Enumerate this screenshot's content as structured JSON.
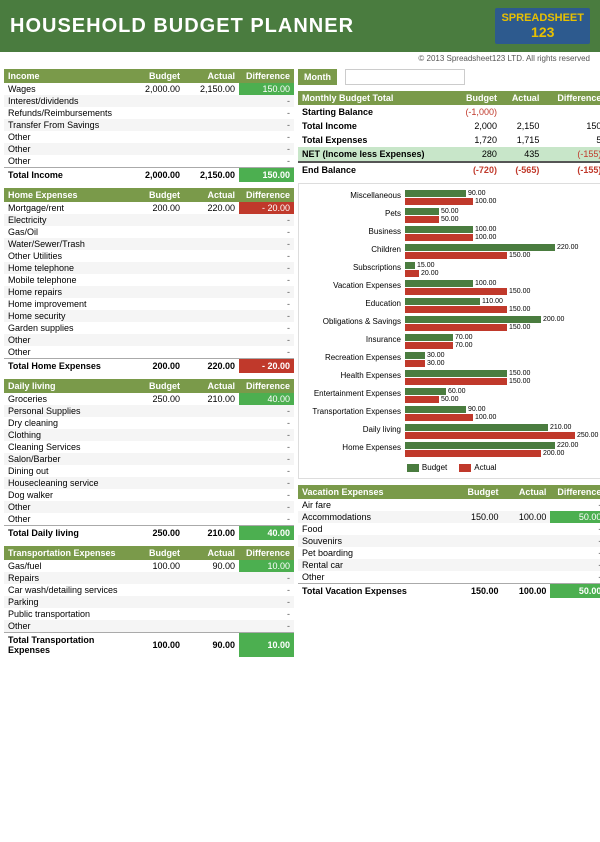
{
  "header": {
    "title": "HOUSEHOLD BUDGET PLANNER",
    "logo_line1": "SPREAD",
    "logo_line2": "SHEET",
    "logo_num": "123",
    "copyright": "© 2013 Spreadsheet123 LTD. All rights reserved"
  },
  "month": {
    "label": "Month",
    "value": ""
  },
  "income": {
    "header": "Income",
    "col_budget": "Budget",
    "col_actual": "Actual",
    "col_diff": "Difference",
    "rows": [
      {
        "label": "Wages",
        "budget": "2,000.00",
        "actual": "2,150.00",
        "diff": "150.00",
        "diff_type": "positive"
      },
      {
        "label": "Interest/dividends",
        "budget": "",
        "actual": "",
        "diff": "-",
        "diff_type": "neutral"
      },
      {
        "label": "Refunds/Reimbursements",
        "budget": "",
        "actual": "",
        "diff": "-",
        "diff_type": "neutral"
      },
      {
        "label": "Transfer From Savings",
        "budget": "",
        "actual": "",
        "diff": "-",
        "diff_type": "neutral"
      },
      {
        "label": "Other",
        "budget": "",
        "actual": "",
        "diff": "-",
        "diff_type": "neutral"
      },
      {
        "label": "Other",
        "budget": "",
        "actual": "",
        "diff": "-",
        "diff_type": "neutral"
      },
      {
        "label": "Other",
        "budget": "",
        "actual": "",
        "diff": "-",
        "diff_type": "neutral"
      }
    ],
    "total_label": "Total Income",
    "total_budget": "2,000.00",
    "total_actual": "2,150.00",
    "total_diff": "150.00",
    "total_diff_type": "positive"
  },
  "home_expenses": {
    "header": "Home Expenses",
    "col_budget": "Budget",
    "col_actual": "Actual",
    "col_diff": "Difference",
    "rows": [
      {
        "label": "Mortgage/rent",
        "budget": "200.00",
        "actual": "220.00",
        "diff": "- 20.00",
        "diff_type": "negative"
      },
      {
        "label": "Electricity",
        "budget": "",
        "actual": "",
        "diff": "-",
        "diff_type": "neutral"
      },
      {
        "label": "Gas/Oil",
        "budget": "",
        "actual": "",
        "diff": "-",
        "diff_type": "neutral"
      },
      {
        "label": "Water/Sewer/Trash",
        "budget": "",
        "actual": "",
        "diff": "-",
        "diff_type": "neutral"
      },
      {
        "label": "Other Utilities",
        "budget": "",
        "actual": "",
        "diff": "-",
        "diff_type": "neutral"
      },
      {
        "label": "Home telephone",
        "budget": "",
        "actual": "",
        "diff": "-",
        "diff_type": "neutral"
      },
      {
        "label": "Mobile telephone",
        "budget": "",
        "actual": "",
        "diff": "-",
        "diff_type": "neutral"
      },
      {
        "label": "Home repairs",
        "budget": "",
        "actual": "",
        "diff": "-",
        "diff_type": "neutral"
      },
      {
        "label": "Home improvement",
        "budget": "",
        "actual": "",
        "diff": "-",
        "diff_type": "neutral"
      },
      {
        "label": "Home security",
        "budget": "",
        "actual": "",
        "diff": "-",
        "diff_type": "neutral"
      },
      {
        "label": "Garden supplies",
        "budget": "",
        "actual": "",
        "diff": "-",
        "diff_type": "neutral"
      },
      {
        "label": "Other",
        "budget": "",
        "actual": "",
        "diff": "-",
        "diff_type": "neutral"
      },
      {
        "label": "Other",
        "budget": "",
        "actual": "",
        "diff": "-",
        "diff_type": "neutral"
      }
    ],
    "total_label": "Total Home Expenses",
    "total_budget": "200.00",
    "total_actual": "220.00",
    "total_diff": "- 20.00",
    "total_diff_type": "negative"
  },
  "daily_living": {
    "header": "Daily living",
    "col_budget": "Budget",
    "col_actual": "Actual",
    "col_diff": "Difference",
    "rows": [
      {
        "label": "Groceries",
        "budget": "250.00",
        "actual": "210.00",
        "diff": "40.00",
        "diff_type": "positive"
      },
      {
        "label": "Personal Supplies",
        "budget": "",
        "actual": "",
        "diff": "-",
        "diff_type": "neutral"
      },
      {
        "label": "Dry cleaning",
        "budget": "",
        "actual": "",
        "diff": "-",
        "diff_type": "neutral"
      },
      {
        "label": "Clothing",
        "budget": "",
        "actual": "",
        "diff": "-",
        "diff_type": "neutral"
      },
      {
        "label": "Cleaning Services",
        "budget": "",
        "actual": "",
        "diff": "-",
        "diff_type": "neutral"
      },
      {
        "label": "Salon/Barber",
        "budget": "",
        "actual": "",
        "diff": "-",
        "diff_type": "neutral"
      },
      {
        "label": "Dining out",
        "budget": "",
        "actual": "",
        "diff": "-",
        "diff_type": "neutral"
      },
      {
        "label": "Housecleaning service",
        "budget": "",
        "actual": "",
        "diff": "-",
        "diff_type": "neutral"
      },
      {
        "label": "Dog walker",
        "budget": "",
        "actual": "",
        "diff": "-",
        "diff_type": "neutral"
      },
      {
        "label": "Other",
        "budget": "",
        "actual": "",
        "diff": "-",
        "diff_type": "neutral"
      },
      {
        "label": "Other",
        "budget": "",
        "actual": "",
        "diff": "-",
        "diff_type": "neutral"
      }
    ],
    "total_label": "Total Daily living",
    "total_budget": "250.00",
    "total_actual": "210.00",
    "total_diff": "40.00",
    "total_diff_type": "positive"
  },
  "transport": {
    "header": "Transportation Expenses",
    "col_budget": "Budget",
    "col_actual": "Actual",
    "col_diff": "Difference",
    "rows": [
      {
        "label": "Gas/fuel",
        "budget": "100.00",
        "actual": "90.00",
        "diff": "10.00",
        "diff_type": "positive"
      },
      {
        "label": "Repairs",
        "budget": "",
        "actual": "",
        "diff": "-",
        "diff_type": "neutral"
      },
      {
        "label": "Car wash/detailing services",
        "budget": "",
        "actual": "",
        "diff": "-",
        "diff_type": "neutral"
      },
      {
        "label": "Parking",
        "budget": "",
        "actual": "",
        "diff": "-",
        "diff_type": "neutral"
      },
      {
        "label": "Public transportation",
        "budget": "",
        "actual": "",
        "diff": "-",
        "diff_type": "neutral"
      },
      {
        "label": "Other",
        "budget": "",
        "actual": "",
        "diff": "-",
        "diff_type": "neutral"
      }
    ],
    "total_label": "Total Transportation Expenses",
    "total_budget": "100.00",
    "total_actual": "90.00",
    "total_diff": "10.00",
    "total_diff_type": "positive"
  },
  "monthly_budget": {
    "header": "Monthly Budget Total",
    "col_budget": "Budget",
    "col_actual": "Actual",
    "col_diff": "Difference",
    "rows": [
      {
        "label": "Starting Balance",
        "budget": "(-1,000)",
        "actual": "",
        "diff": "",
        "style": "red"
      },
      {
        "label": "Total Income",
        "budget": "2,000",
        "actual": "2,150",
        "diff": "150",
        "style": "normal"
      },
      {
        "label": "Total Expenses",
        "budget": "1,720",
        "actual": "1,715",
        "diff": "5",
        "style": "normal"
      },
      {
        "label": "NET (Income less Expenses)",
        "budget": "280",
        "actual": "435",
        "diff": "(-155)",
        "style": "green-bg",
        "diff_neg": true
      },
      {
        "label": "End Balance",
        "budget": "(-720)",
        "actual": "(-565)",
        "diff": "(-155)",
        "style": "bold",
        "all_neg": true
      }
    ]
  },
  "chart": {
    "title": "",
    "legend_budget": "Budget",
    "legend_actual": "Actual",
    "rows": [
      {
        "label": "Miscellaneous",
        "budget": 90,
        "actual": 100,
        "budget_label": "90.00",
        "actual_label": "100.00"
      },
      {
        "label": "Pets",
        "budget": 50,
        "actual": 50,
        "budget_label": "50.00",
        "actual_label": "50.00"
      },
      {
        "label": "Business",
        "budget": 100,
        "actual": 100,
        "budget_label": "100.00",
        "actual_label": "100.00"
      },
      {
        "label": "Children",
        "budget": 220,
        "actual": 150,
        "budget_label": "220.00",
        "actual_label": "150.00"
      },
      {
        "label": "Subscriptions",
        "budget": 15,
        "actual": 20,
        "budget_label": "15.00",
        "actual_label": "20.00"
      },
      {
        "label": "Vacation Expenses",
        "budget": 100,
        "actual": 150,
        "budget_label": "100.00",
        "actual_label": "150.00"
      },
      {
        "label": "Education",
        "budget": 110,
        "actual": 150,
        "budget_label": "110.00",
        "actual_label": "150.00"
      },
      {
        "label": "Obligations & Savings",
        "budget": 200,
        "actual": 150,
        "budget_label": "200.00",
        "actual_label": "150.00"
      },
      {
        "label": "Insurance",
        "budget": 70,
        "actual": 70,
        "budget_label": "70.00",
        "actual_label": "70.00"
      },
      {
        "label": "Recreation Expenses",
        "budget": 30,
        "actual": 30,
        "budget_label": "30.00",
        "actual_label": "30.00"
      },
      {
        "label": "Health Expenses",
        "budget": 150,
        "actual": 150,
        "budget_label": "150.00",
        "actual_label": "150.00"
      },
      {
        "label": "Entertainment Expenses",
        "budget": 60,
        "actual": 50,
        "budget_label": "60.00",
        "actual_label": "50.00"
      },
      {
        "label": "Transportation Expenses",
        "budget": 90,
        "actual": 100,
        "budget_label": "90.00",
        "actual_label": "100.00"
      },
      {
        "label": "Daily living",
        "budget": 210,
        "actual": 250,
        "budget_label": "210.00",
        "actual_label": "250.00"
      },
      {
        "label": "Home Expenses",
        "budget": 220,
        "actual": 200,
        "budget_label": "220.00",
        "actual_label": "200.00"
      }
    ],
    "max_val": 250
  },
  "vacation": {
    "header": "Vacation Expenses",
    "col_budget": "Budget",
    "col_actual": "Actual",
    "col_diff": "Difference",
    "rows": [
      {
        "label": "Air fare",
        "budget": "",
        "actual": "",
        "diff": "-",
        "diff_type": "neutral"
      },
      {
        "label": "Accommodations",
        "budget": "150.00",
        "actual": "100.00",
        "diff": "50.00",
        "diff_type": "positive"
      },
      {
        "label": "Food",
        "budget": "",
        "actual": "",
        "diff": "-",
        "diff_type": "neutral"
      },
      {
        "label": "Souvenirs",
        "budget": "",
        "actual": "",
        "diff": "-",
        "diff_type": "neutral"
      },
      {
        "label": "Pet boarding",
        "budget": "",
        "actual": "",
        "diff": "-",
        "diff_type": "neutral"
      },
      {
        "label": "Rental car",
        "budget": "",
        "actual": "",
        "diff": "-",
        "diff_type": "neutral"
      },
      {
        "label": "Other",
        "budget": "",
        "actual": "",
        "diff": "-",
        "diff_type": "neutral"
      }
    ],
    "total_label": "Total Vacation Expenses",
    "total_budget": "150.00",
    "total_actual": "100.00",
    "total_diff": "50.00",
    "total_diff_type": "positive"
  }
}
